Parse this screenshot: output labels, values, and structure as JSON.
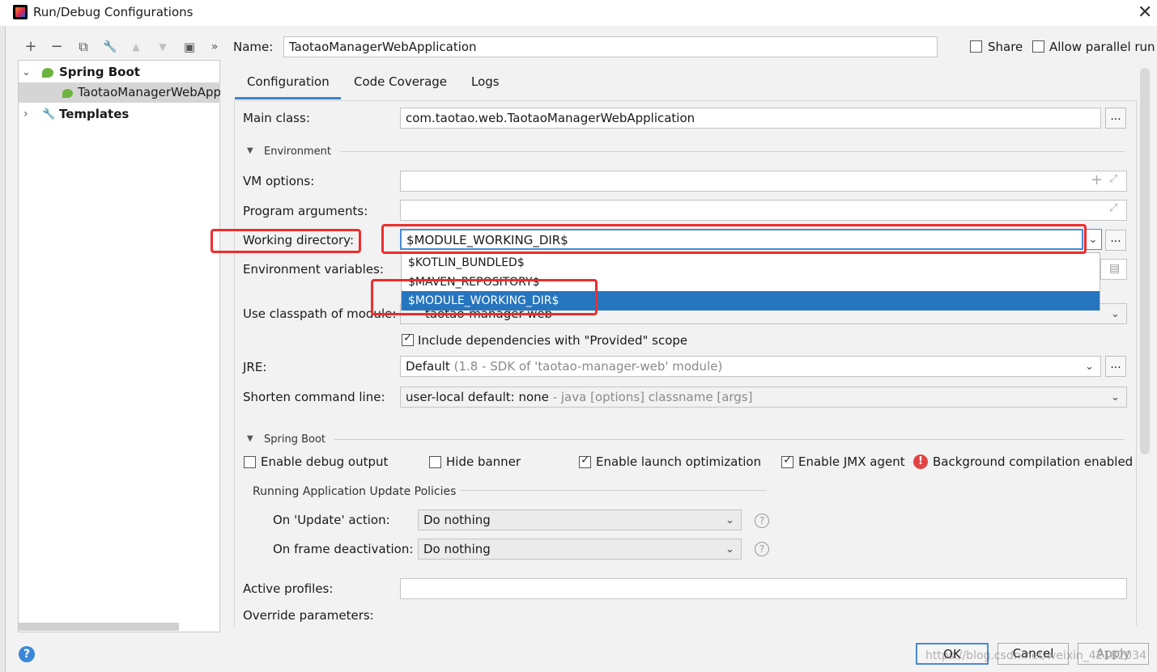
{
  "window": {
    "title": "Run/Debug Configurations"
  },
  "toolbar": {
    "add": "+",
    "remove": "−",
    "copy": "⧉",
    "edit": "🔧",
    "up": "▲",
    "down": "▼",
    "folder": "▣",
    "more": "»"
  },
  "tree": {
    "spring_boot": "Spring Boot",
    "config_item": "TaotaoManagerWebApp",
    "templates": "Templates"
  },
  "header": {
    "name_label": "Name:",
    "name_value": "TaotaoManagerWebApplication",
    "share_label": "Share",
    "parallel_label": "Allow parallel run"
  },
  "tabs": [
    {
      "label": "Configuration"
    },
    {
      "label": "Code Coverage"
    },
    {
      "label": "Logs"
    }
  ],
  "form": {
    "main_class_label": "Main class:",
    "main_class_value": "com.taotao.web.TaotaoManagerWebApplication",
    "environment_title": "Environment",
    "vm_options_label": "VM options:",
    "program_args_label": "Program arguments:",
    "working_dir_label": "Working directory:",
    "working_dir_value": "$MODULE_WORKING_DIR$",
    "env_vars_label": "Environment variables:",
    "classpath_label": "Use classpath of module:",
    "classpath_value": "taotao-manager-web",
    "include_deps_label": "Include dependencies with \"Provided\" scope",
    "jre_label": "JRE:",
    "jre_value_main": "Default",
    "jre_value_hint": "(1.8 - SDK of 'taotao-manager-web' module)",
    "shorten_label": "Shorten command line:",
    "shorten_value_main": "user-local default: none",
    "shorten_value_hint": "- java [options] classname [args]"
  },
  "dropdown": {
    "items": [
      "$KOTLIN_BUNDLED$",
      "$MAVEN_REPOSITORY$",
      "$MODULE_WORKING_DIR$"
    ],
    "selected_index": 2
  },
  "spring_boot": {
    "title": "Spring Boot",
    "debug_output": "Enable debug output",
    "hide_banner": "Hide banner",
    "launch_opt": "Enable launch optimization",
    "jmx_agent": "Enable JMX agent",
    "bg_compile": "Background compilation enabled",
    "policies_title": "Running Application Update Policies",
    "update_action_label": "On 'Update' action:",
    "update_action_value": "Do nothing",
    "frame_deact_label": "On frame deactivation:",
    "frame_deact_value": "Do nothing",
    "active_profiles_label": "Active profiles:",
    "override_params_label": "Override parameters:"
  },
  "checkbox_states": {
    "share": false,
    "parallel": false,
    "include_deps": true,
    "debug_output": false,
    "hide_banner": false,
    "launch_opt": true,
    "jmx_agent": true
  },
  "footer": {
    "ok": "OK",
    "cancel": "Cancel",
    "apply": "Apply",
    "watermark": "https://blog.csdn.net/weixin_42182034"
  },
  "colors": {
    "accent": "#2675bf",
    "highlight_box": "#ee2d2d",
    "spring_green": "#6db33f"
  }
}
